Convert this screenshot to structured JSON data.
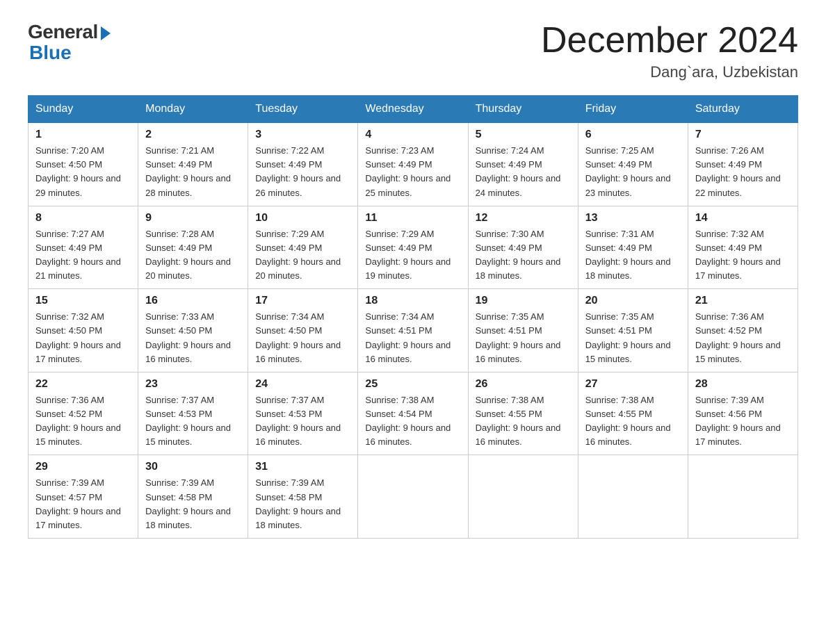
{
  "header": {
    "logo_general": "General",
    "logo_blue": "Blue",
    "month_title": "December 2024",
    "location": "Dang`ara, Uzbekistan"
  },
  "days_of_week": [
    "Sunday",
    "Monday",
    "Tuesday",
    "Wednesday",
    "Thursday",
    "Friday",
    "Saturday"
  ],
  "weeks": [
    [
      {
        "day": "1",
        "sunrise": "7:20 AM",
        "sunset": "4:50 PM",
        "daylight": "9 hours and 29 minutes."
      },
      {
        "day": "2",
        "sunrise": "7:21 AM",
        "sunset": "4:49 PM",
        "daylight": "9 hours and 28 minutes."
      },
      {
        "day": "3",
        "sunrise": "7:22 AM",
        "sunset": "4:49 PM",
        "daylight": "9 hours and 26 minutes."
      },
      {
        "day": "4",
        "sunrise": "7:23 AM",
        "sunset": "4:49 PM",
        "daylight": "9 hours and 25 minutes."
      },
      {
        "day": "5",
        "sunrise": "7:24 AM",
        "sunset": "4:49 PM",
        "daylight": "9 hours and 24 minutes."
      },
      {
        "day": "6",
        "sunrise": "7:25 AM",
        "sunset": "4:49 PM",
        "daylight": "9 hours and 23 minutes."
      },
      {
        "day": "7",
        "sunrise": "7:26 AM",
        "sunset": "4:49 PM",
        "daylight": "9 hours and 22 minutes."
      }
    ],
    [
      {
        "day": "8",
        "sunrise": "7:27 AM",
        "sunset": "4:49 PM",
        "daylight": "9 hours and 21 minutes."
      },
      {
        "day": "9",
        "sunrise": "7:28 AM",
        "sunset": "4:49 PM",
        "daylight": "9 hours and 20 minutes."
      },
      {
        "day": "10",
        "sunrise": "7:29 AM",
        "sunset": "4:49 PM",
        "daylight": "9 hours and 20 minutes."
      },
      {
        "day": "11",
        "sunrise": "7:29 AM",
        "sunset": "4:49 PM",
        "daylight": "9 hours and 19 minutes."
      },
      {
        "day": "12",
        "sunrise": "7:30 AM",
        "sunset": "4:49 PM",
        "daylight": "9 hours and 18 minutes."
      },
      {
        "day": "13",
        "sunrise": "7:31 AM",
        "sunset": "4:49 PM",
        "daylight": "9 hours and 18 minutes."
      },
      {
        "day": "14",
        "sunrise": "7:32 AM",
        "sunset": "4:49 PM",
        "daylight": "9 hours and 17 minutes."
      }
    ],
    [
      {
        "day": "15",
        "sunrise": "7:32 AM",
        "sunset": "4:50 PM",
        "daylight": "9 hours and 17 minutes."
      },
      {
        "day": "16",
        "sunrise": "7:33 AM",
        "sunset": "4:50 PM",
        "daylight": "9 hours and 16 minutes."
      },
      {
        "day": "17",
        "sunrise": "7:34 AM",
        "sunset": "4:50 PM",
        "daylight": "9 hours and 16 minutes."
      },
      {
        "day": "18",
        "sunrise": "7:34 AM",
        "sunset": "4:51 PM",
        "daylight": "9 hours and 16 minutes."
      },
      {
        "day": "19",
        "sunrise": "7:35 AM",
        "sunset": "4:51 PM",
        "daylight": "9 hours and 16 minutes."
      },
      {
        "day": "20",
        "sunrise": "7:35 AM",
        "sunset": "4:51 PM",
        "daylight": "9 hours and 15 minutes."
      },
      {
        "day": "21",
        "sunrise": "7:36 AM",
        "sunset": "4:52 PM",
        "daylight": "9 hours and 15 minutes."
      }
    ],
    [
      {
        "day": "22",
        "sunrise": "7:36 AM",
        "sunset": "4:52 PM",
        "daylight": "9 hours and 15 minutes."
      },
      {
        "day": "23",
        "sunrise": "7:37 AM",
        "sunset": "4:53 PM",
        "daylight": "9 hours and 15 minutes."
      },
      {
        "day": "24",
        "sunrise": "7:37 AM",
        "sunset": "4:53 PM",
        "daylight": "9 hours and 16 minutes."
      },
      {
        "day": "25",
        "sunrise": "7:38 AM",
        "sunset": "4:54 PM",
        "daylight": "9 hours and 16 minutes."
      },
      {
        "day": "26",
        "sunrise": "7:38 AM",
        "sunset": "4:55 PM",
        "daylight": "9 hours and 16 minutes."
      },
      {
        "day": "27",
        "sunrise": "7:38 AM",
        "sunset": "4:55 PM",
        "daylight": "9 hours and 16 minutes."
      },
      {
        "day": "28",
        "sunrise": "7:39 AM",
        "sunset": "4:56 PM",
        "daylight": "9 hours and 17 minutes."
      }
    ],
    [
      {
        "day": "29",
        "sunrise": "7:39 AM",
        "sunset": "4:57 PM",
        "daylight": "9 hours and 17 minutes."
      },
      {
        "day": "30",
        "sunrise": "7:39 AM",
        "sunset": "4:58 PM",
        "daylight": "9 hours and 18 minutes."
      },
      {
        "day": "31",
        "sunrise": "7:39 AM",
        "sunset": "4:58 PM",
        "daylight": "9 hours and 18 minutes."
      },
      null,
      null,
      null,
      null
    ]
  ]
}
